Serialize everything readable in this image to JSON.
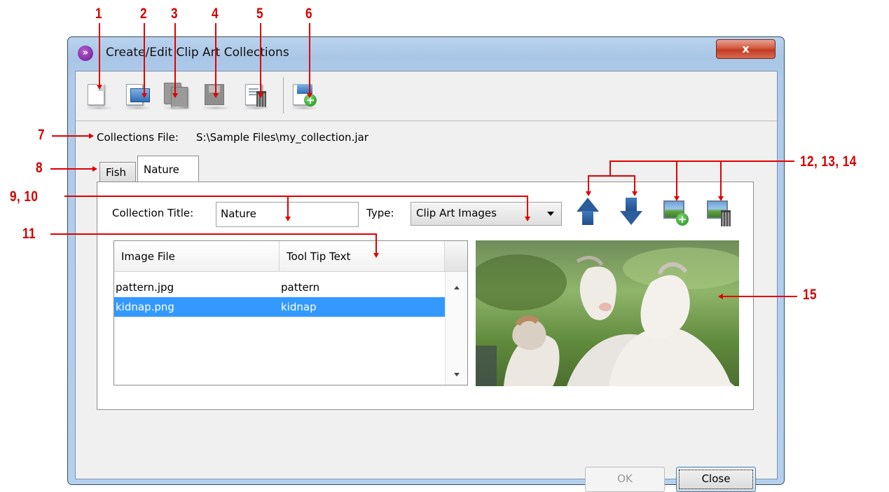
{
  "window": {
    "title": "Create/Edit Clip Art Collections",
    "close_symbol": "x"
  },
  "toolbar": {
    "buttons": [
      {
        "name": "new-collection-file",
        "icon": "new-document-icon",
        "enabled": true
      },
      {
        "name": "open-collection-file",
        "icon": "open-document-icon",
        "enabled": true
      },
      {
        "name": "save-as",
        "icon": "copy-document-icon",
        "enabled": false
      },
      {
        "name": "save",
        "icon": "save-icon",
        "enabled": false
      },
      {
        "name": "delete-collection",
        "icon": "delete-collection-icon",
        "enabled": true
      },
      {
        "name": "add-collection",
        "icon": "add-collection-icon",
        "enabled": true
      }
    ]
  },
  "collections_file": {
    "label": "Collections File:",
    "path": "S:\\Sample Files\\my_collection.jar"
  },
  "tabs": [
    {
      "label": "Fish",
      "selected": false
    },
    {
      "label": "Nature",
      "selected": true
    }
  ],
  "form": {
    "title_label": "Collection Title:",
    "title_value": "Nature",
    "type_label": "Type:",
    "type_value": "Clip Art Images"
  },
  "table": {
    "columns": [
      "Image File",
      "Tool Tip Text"
    ],
    "rows": [
      {
        "file": "pattern.jpg",
        "tip": "pattern",
        "selected": false
      },
      {
        "file": "kidnap.png",
        "tip": "kidnap",
        "selected": true
      }
    ]
  },
  "buttons": {
    "ok": "OK",
    "close": "Close"
  },
  "callouts": {
    "c1": "1",
    "c2": "2",
    "c3": "3",
    "c4": "4",
    "c5": "5",
    "c6": "6",
    "c7": "7",
    "c8": "8",
    "c9": "9, 10",
    "c11": "11",
    "c12": "12, 13, 14",
    "c15": "15"
  },
  "colors": {
    "callout": "#e10000",
    "selection": "#3399ff",
    "arrow_blue": "#2b5c9c"
  }
}
